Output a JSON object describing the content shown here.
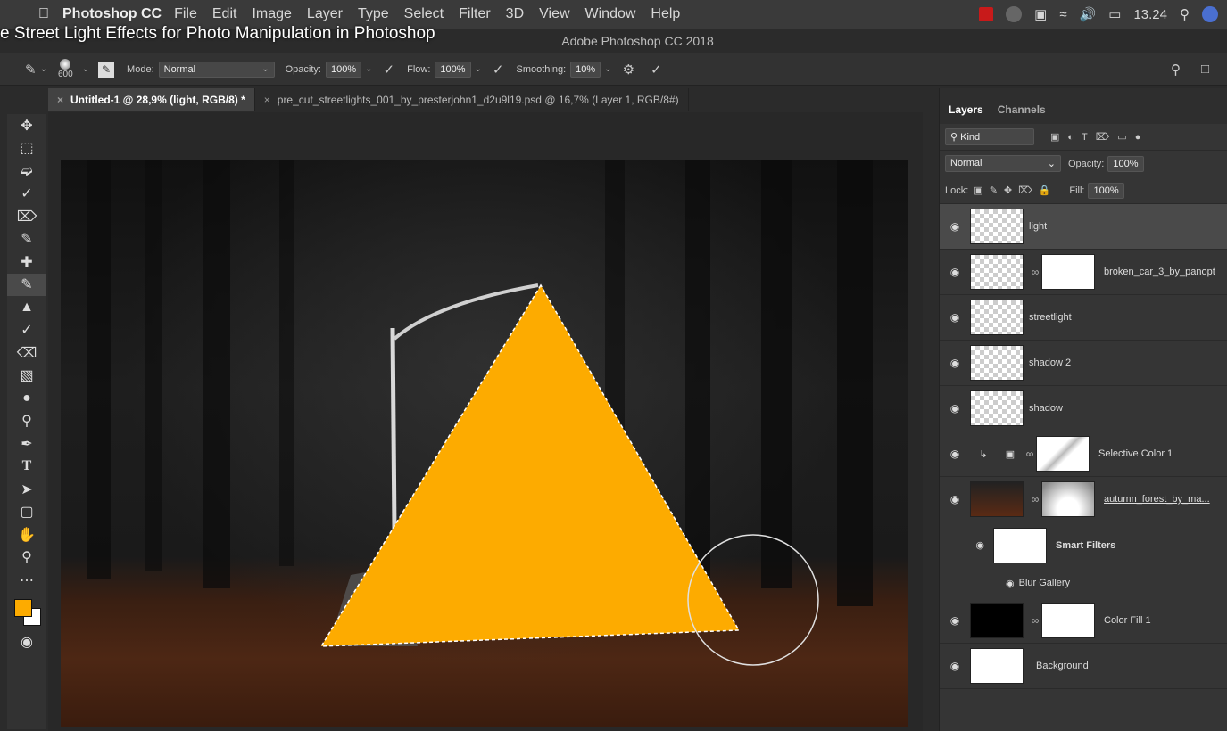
{
  "menubar": {
    "app_name": "Photoshop CC",
    "menus": [
      "File",
      "Edit",
      "Image",
      "Layer",
      "Type",
      "Select",
      "Filter",
      "3D",
      "View",
      "Window",
      "Help"
    ],
    "clock": "13.24"
  },
  "video_title": "e Street Light Effects for Photo Manipulation in Photoshop",
  "window_title": "Adobe Photoshop CC 2018",
  "options": {
    "brush_size": "600",
    "mode_label": "Mode:",
    "mode_value": "Normal",
    "opacity_label": "Opacity:",
    "opacity_value": "100%",
    "flow_label": "Flow:",
    "flow_value": "100%",
    "smoothing_label": "Smoothing:",
    "smoothing_value": "10%"
  },
  "tabs": [
    {
      "label": "Untitled-1 @ 28,9% (light, RGB/8) *",
      "active": true
    },
    {
      "label": "pre_cut_streetlights_001_by_presterjohn1_d2u9l19.psd @ 16,7% (Layer 1, RGB/8#)",
      "active": false
    }
  ],
  "colors": {
    "foreground": "#fdab00",
    "background": "#ffffff",
    "selection_fill": "#fdab00"
  },
  "panel": {
    "tabs": [
      "Layers",
      "Channels"
    ],
    "filter_kind": "Kind",
    "blend_mode": "Normal",
    "opacity_label": "Opacity:",
    "opacity_value": "100%",
    "lock_label": "Lock:",
    "fill_label": "Fill:",
    "fill_value": "100%",
    "layers": [
      {
        "name": "light",
        "thumb": "transparent",
        "mask": false,
        "selected": true
      },
      {
        "name": "broken_car_3_by_panopt",
        "thumb": "transparent",
        "mask": true,
        "selected": false
      },
      {
        "name": "streetlight",
        "thumb": "transparent",
        "mask": false,
        "selected": false
      },
      {
        "name": "shadow 2",
        "thumb": "transparent",
        "mask": false,
        "selected": false
      },
      {
        "name": "shadow",
        "thumb": "transparent",
        "mask": false,
        "selected": false
      },
      {
        "name": "Selective Color 1",
        "thumb": "adjustment",
        "mask": true,
        "selected": false
      },
      {
        "name": "autumn_forest_by_ma...",
        "thumb": "forest",
        "mask": true,
        "selected": false
      }
    ],
    "smart_filters_label": "Smart Filters",
    "blur_gallery_label": "Blur Gallery",
    "color_fill_name": "Color Fill 1",
    "background_name": "Background"
  }
}
